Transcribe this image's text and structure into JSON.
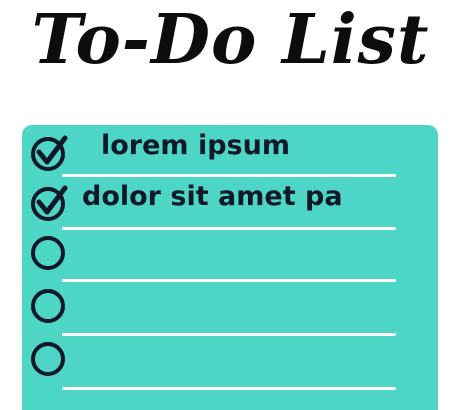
{
  "title": "To-Do List",
  "colors": {
    "card": "#4dd6c5",
    "text": "#111827",
    "line": "#ffffff"
  },
  "items": [
    {
      "label": "lorem ipsum",
      "checked": true
    },
    {
      "label": "dolor sit amet pa",
      "checked": true
    },
    {
      "label": "",
      "checked": false
    },
    {
      "label": "",
      "checked": false
    },
    {
      "label": "",
      "checked": false
    }
  ]
}
